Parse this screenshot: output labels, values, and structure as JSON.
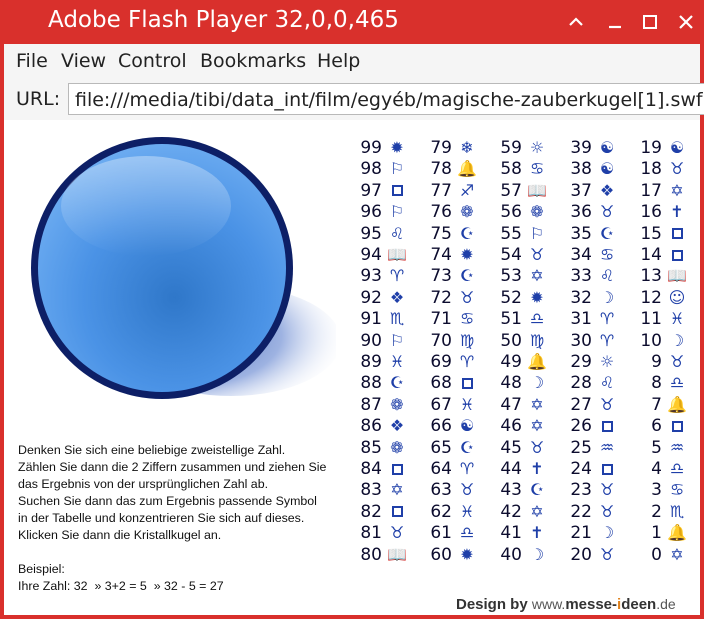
{
  "window": {
    "title": "Adobe Flash Player 32,0,0,465",
    "accent": "#d9302c",
    "buttons": [
      "chevron-up-icon",
      "minimize-icon",
      "maximize-icon",
      "close-icon"
    ]
  },
  "menu": {
    "file": "File",
    "view": "View",
    "control": "Control",
    "bookmarks": "Bookmarks",
    "help": "Help"
  },
  "url": {
    "label": "URL:",
    "value": "file:///media/tibi/data_int/film/egyéb/magische-zauberkugel[1].swf"
  },
  "instructions": {
    "text": "Denken Sie sich eine beliebige zweistellige Zahl.\nZählen Sie dann die 2 Ziffern zusammen und ziehen Sie\ndas Ergebnis von der ursprünglichen Zahl ab.\nSuchen Sie dann das zum Ergebnis passende Symbol\nin der Tabelle und konzentrieren Sie sich auf dieses.\nKlicken Sie dann die Kristallkugel an.\n\nBeispiel:\nIhre Zahl: 32  » 3+2 = 5  » 32 - 5 = 27"
  },
  "credit": {
    "design": "Design by",
    "www": "www.",
    "messe": "messe-",
    "i": "i",
    "deen": "deen",
    "tld": ".de"
  },
  "symbol_table": {
    "columns": [
      [
        [
          "99",
          "✹"
        ],
        [
          "98",
          "⚐"
        ],
        [
          "97",
          "☐"
        ],
        [
          "96",
          "⚐"
        ],
        [
          "95",
          "♌"
        ],
        [
          "94",
          "📖"
        ],
        [
          "93",
          "♈"
        ],
        [
          "92",
          "❖"
        ],
        [
          "91",
          "♏"
        ],
        [
          "90",
          "⚐"
        ],
        [
          "89",
          "♓"
        ],
        [
          "88",
          "☪"
        ],
        [
          "87",
          "❁"
        ],
        [
          "86",
          "❖"
        ],
        [
          "85",
          "❁"
        ],
        [
          "84",
          "☐"
        ],
        [
          "83",
          "✡"
        ],
        [
          "82",
          "☐"
        ],
        [
          "81",
          "♉"
        ],
        [
          "80",
          "📖"
        ]
      ],
      [
        [
          "79",
          "❄"
        ],
        [
          "78",
          "🔔"
        ],
        [
          "77",
          "♐"
        ],
        [
          "76",
          "❁"
        ],
        [
          "75",
          "☪"
        ],
        [
          "74",
          "✹"
        ],
        [
          "73",
          "☪"
        ],
        [
          "72",
          "♉"
        ],
        [
          "71",
          "♋"
        ],
        [
          "70",
          "♍"
        ],
        [
          "69",
          "♈"
        ],
        [
          "68",
          "☐"
        ],
        [
          "67",
          "♓"
        ],
        [
          "66",
          "☯"
        ],
        [
          "65",
          "☪"
        ],
        [
          "64",
          "♈"
        ],
        [
          "63",
          "♉"
        ],
        [
          "62",
          "♓"
        ],
        [
          "61",
          "♎"
        ],
        [
          "60",
          "✹"
        ]
      ],
      [
        [
          "59",
          "☼"
        ],
        [
          "58",
          "♋"
        ],
        [
          "57",
          "📖"
        ],
        [
          "56",
          "❁"
        ],
        [
          "55",
          "⚐"
        ],
        [
          "54",
          "♉"
        ],
        [
          "53",
          "✡"
        ],
        [
          "52",
          "✹"
        ],
        [
          "51",
          "♎"
        ],
        [
          "50",
          "♍"
        ],
        [
          "49",
          "🔔"
        ],
        [
          "48",
          "☽"
        ],
        [
          "47",
          "✡"
        ],
        [
          "46",
          "✡"
        ],
        [
          "45",
          "♉"
        ],
        [
          "44",
          "✝"
        ],
        [
          "43",
          "☪"
        ],
        [
          "42",
          "✡"
        ],
        [
          "41",
          "✝"
        ],
        [
          "40",
          "☽"
        ]
      ],
      [
        [
          "39",
          "☯"
        ],
        [
          "38",
          "☯"
        ],
        [
          "37",
          "❖"
        ],
        [
          "36",
          "♉"
        ],
        [
          "35",
          "☪"
        ],
        [
          "34",
          "♋"
        ],
        [
          "33",
          "♌"
        ],
        [
          "32",
          "☽"
        ],
        [
          "31",
          "♈"
        ],
        [
          "30",
          "♈"
        ],
        [
          "29",
          "☼"
        ],
        [
          "28",
          "♌"
        ],
        [
          "27",
          "♉"
        ],
        [
          "26",
          "☐"
        ],
        [
          "25",
          "♒"
        ],
        [
          "24",
          "☐"
        ],
        [
          "23",
          "♉"
        ],
        [
          "22",
          "♉"
        ],
        [
          "21",
          "☽"
        ],
        [
          "20",
          "♉"
        ]
      ],
      [
        [
          "19",
          "☯"
        ],
        [
          "18",
          "♉"
        ],
        [
          "17",
          "✡"
        ],
        [
          "16",
          "✝"
        ],
        [
          "15",
          "☐"
        ],
        [
          "14",
          "☐"
        ],
        [
          "13",
          "📖"
        ],
        [
          "12",
          "☺"
        ],
        [
          "11",
          "♓"
        ],
        [
          "10",
          "☽"
        ],
        [
          "9",
          "♉"
        ],
        [
          "8",
          "♎"
        ],
        [
          "7",
          "🔔"
        ],
        [
          "6",
          "☐"
        ],
        [
          "5",
          "♒"
        ],
        [
          "4",
          "♎"
        ],
        [
          "3",
          "♋"
        ],
        [
          "2",
          "♏"
        ],
        [
          "1",
          "🔔"
        ],
        [
          "0",
          "✡"
        ]
      ]
    ]
  }
}
